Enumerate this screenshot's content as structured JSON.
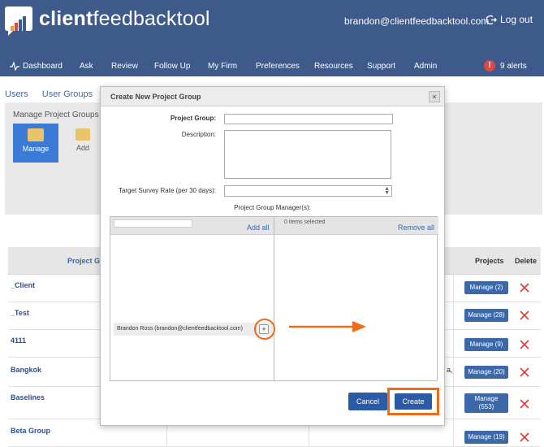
{
  "header": {
    "brand_bold": "client",
    "brand_light": "feedbacktool",
    "user_email": "brandon@clientfeedbacktool.com",
    "logout_label": "Log out",
    "nav": [
      "Dashboard",
      "Ask",
      "Review",
      "Follow Up",
      "My Firm",
      "Preferences",
      "Resources",
      "Support",
      "Admin"
    ],
    "alert_count_label": "9 alerts",
    "alert_glyph": "!"
  },
  "page": {
    "tabs": [
      "Users",
      "User Groups"
    ],
    "panel_title": "Manage Project Groups",
    "tile_manage": "Manage",
    "tile_add": "Add",
    "table": {
      "headers": {
        "name": "Project Gro",
        "projects": "Projects",
        "delete": "Delete"
      },
      "rows": [
        {
          "name": "_Client",
          "manage": "Manage (2)"
        },
        {
          "name": "_Test",
          "manage": "Manage (28)"
        },
        {
          "name": "4111",
          "manage": "Manage (9)"
        },
        {
          "name": "Bangkok",
          "manage": "Manage (20)",
          "extra": "a,"
        },
        {
          "name": "Baselines",
          "manage": "Manage (553)"
        },
        {
          "name": "Beta Group",
          "manage": "Manage (19)"
        }
      ]
    }
  },
  "modal": {
    "title": "Create New Project Group",
    "close_glyph": "×",
    "project_group_label": "Project Group:",
    "project_group_value": "",
    "description_label": "Description:",
    "description_value": "",
    "target_rate_label": "Target Survey Rate (per 30 days):",
    "target_rate_value": "",
    "managers_title": "Project Group Manager(s):",
    "add_all": "Add all",
    "remove_all": "Remove all",
    "selected_count": "0 items selected",
    "available_items": [
      "Brandon Ross (brandon@clientfeedbacktool.com)"
    ],
    "plus_glyph": "+",
    "cancel_label": "Cancel",
    "create_label": "Create"
  },
  "colors": {
    "header_bg": "#3e5a8a",
    "accent_blue": "#2b5aa6",
    "highlight_orange": "#f06a1a",
    "delete_red": "#e03a3a"
  }
}
